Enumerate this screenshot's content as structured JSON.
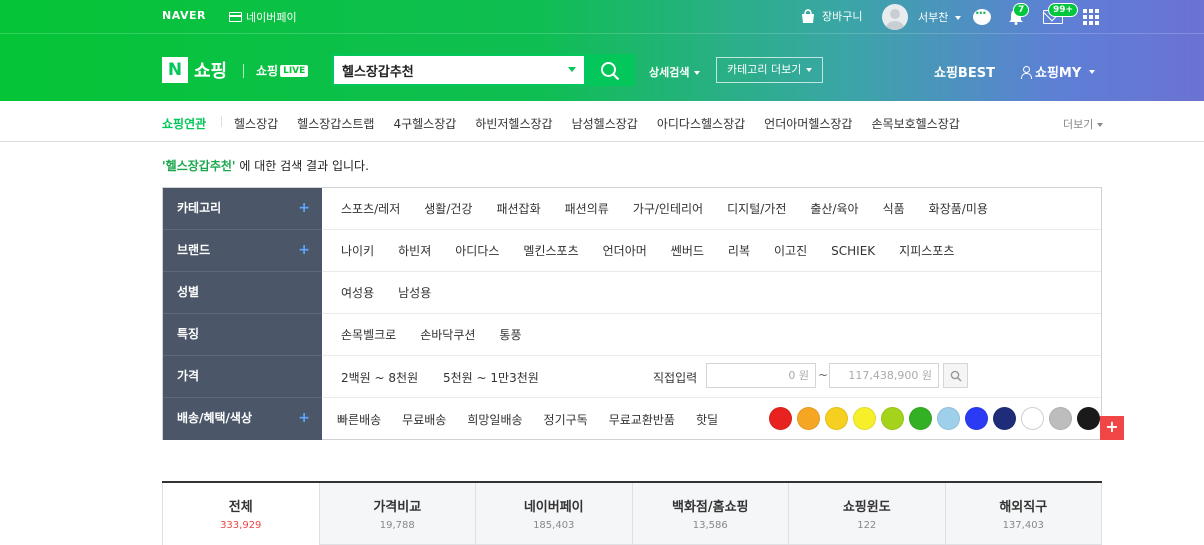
{
  "gnb": {
    "logo": "NAVER",
    "npay": "네이버페이",
    "cart": "장바구니",
    "username": "서부찬",
    "bell_badge": "7",
    "mail_badge": "99+"
  },
  "header": {
    "logo_n": "N",
    "logo_shop": "쇼핑",
    "live_label": "쇼핑",
    "live_tag": "LIVE",
    "search_value": "헬스장갑추천",
    "detail_search": "상세검색",
    "category_more": "카테고리 더보기",
    "shop_best": "쇼핑BEST",
    "shop_my": "쇼핑MY"
  },
  "related": {
    "title": "쇼핑연관",
    "items": [
      "헬스장갑",
      "헬스장갑스트랩",
      "4구헬스장갑",
      "하빈저헬스장갑",
      "남성헬스장갑",
      "아디다스헬스장갑",
      "언더아머헬스장갑",
      "손목보호헬스장갑"
    ],
    "more": "더보기"
  },
  "result": {
    "keyword": "'헬스장갑추천'",
    "suffix": " 에 대한 검색 결과 입니다."
  },
  "filters": {
    "category": {
      "label": "카테고리",
      "plus": "+",
      "values": [
        "스포츠/레저",
        "생활/건강",
        "패션잡화",
        "패션의류",
        "가구/인테리어",
        "디지털/가전",
        "출산/육아",
        "식품",
        "화장품/미용"
      ]
    },
    "brand": {
      "label": "브랜드",
      "plus": "+",
      "values": [
        "나이키",
        "하빈져",
        "아디다스",
        "멜킨스포츠",
        "언더아머",
        "쎈버드",
        "리복",
        "이고진",
        "SCHIEK",
        "지피스포츠"
      ]
    },
    "gender": {
      "label": "성별",
      "values": [
        "여성용",
        "남성용"
      ]
    },
    "feature": {
      "label": "특징",
      "values": [
        "손목벨크로",
        "손바닥쿠션",
        "통풍"
      ]
    },
    "price": {
      "label": "가격",
      "range1": "2백원 ~ 8천원",
      "range2": "5천원 ~ 1만3천원",
      "direct": "직접입력",
      "min": "0 원",
      "tilde": "~",
      "max": "117,438,900 원"
    },
    "shipping": {
      "label": "배송/혜택/색상",
      "plus": "+",
      "values": [
        "빠른배송",
        "무료배송",
        "희망일배송",
        "정기구독",
        "무료교환반품",
        "핫딜"
      ],
      "colors": [
        "#e8231f",
        "#f5a623",
        "#f5d020",
        "#f7ef2a",
        "#a5d31b",
        "#34b024",
        "#9ed0ec",
        "#2b3bf5",
        "#1f2c7a",
        "#ffffff",
        "#bdbdbd",
        "#1a1a1a"
      ]
    }
  },
  "tabs": [
    {
      "name": "전체",
      "count": "333,929"
    },
    {
      "name": "가격비교",
      "count": "19,788"
    },
    {
      "name": "네이버페이",
      "count": "185,403"
    },
    {
      "name": "백화점/홈쇼핑",
      "count": "13,586"
    },
    {
      "name": "쇼핑윈도",
      "count": "122"
    },
    {
      "name": "해외직구",
      "count": "137,403"
    }
  ]
}
